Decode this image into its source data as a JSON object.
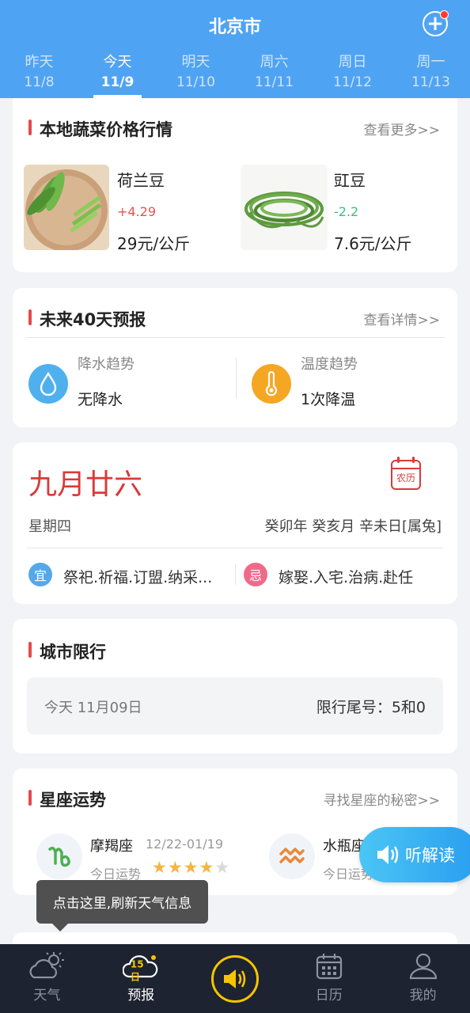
{
  "header": {
    "city": "北京市",
    "tabs": [
      {
        "label": "昨天",
        "date": "11/8"
      },
      {
        "label": "今天",
        "date": "11/9"
      },
      {
        "label": "明天",
        "date": "11/10"
      },
      {
        "label": "周六",
        "date": "11/11"
      },
      {
        "label": "周日",
        "date": "11/12"
      },
      {
        "label": "周一",
        "date": "11/13"
      }
    ],
    "active_tab": 1
  },
  "vegetables": {
    "title": "本地蔬菜价格行情",
    "more": "查看更多>>",
    "items": [
      {
        "name": "荷兰豆",
        "change": "+4.29",
        "price": "29元/公斤",
        "change_color": "#e05555"
      },
      {
        "name": "豇豆",
        "change": "-2.2",
        "price": "7.6元/公斤",
        "change_color": "#3dbb8a"
      }
    ]
  },
  "forecast40": {
    "title": "未来40天预报",
    "more": "查看详情>>",
    "rain": {
      "label": "降水趋势",
      "value": "无降水",
      "icon": "water-drop-icon"
    },
    "temp": {
      "label": "温度趋势",
      "value": "1次降温",
      "icon": "thermometer-icon"
    }
  },
  "almanac": {
    "lunar_date": "九月廿六",
    "badge": "农历",
    "weekday": "星期四",
    "ganzhi": "癸卯年 癸亥月 辛未日[属兔]",
    "yi_label": "宜",
    "yi": "祭祀.祈福.订盟.纳采...",
    "ji_label": "忌",
    "ji": "嫁娶.入宅.治病.赴任"
  },
  "restriction": {
    "title": "城市限行",
    "date": "今天  11月09日",
    "number": "限行尾号：5和0"
  },
  "horoscope": {
    "title": "星座运势",
    "more": "寻找星座的秘密>>",
    "items": [
      {
        "name": "摩羯座",
        "range": "12/22-01/19",
        "luck_label": "今日运势",
        "stars": 4,
        "icon": "capricorn-icon"
      },
      {
        "name": "水瓶座",
        "luck_label": "今日运势",
        "icon": "aquarius-icon"
      }
    ]
  },
  "listen_button": "听解读",
  "tooltip": "点击这里,刷新天气信息",
  "bottom_nav": {
    "items": [
      {
        "label": "天气",
        "icon": "weather-icon"
      },
      {
        "label": "预报",
        "icon": "forecast-icon",
        "badge": "15日"
      },
      {
        "label": "",
        "icon": "speaker-icon"
      },
      {
        "label": "日历",
        "icon": "calendar-icon"
      },
      {
        "label": "我的",
        "icon": "profile-icon"
      }
    ],
    "active": 1
  },
  "colors": {
    "header": "#4fa3f3",
    "accent_red": "#d93a3a",
    "nav_bg": "#1d2330",
    "center_ring": "#f6c400"
  }
}
